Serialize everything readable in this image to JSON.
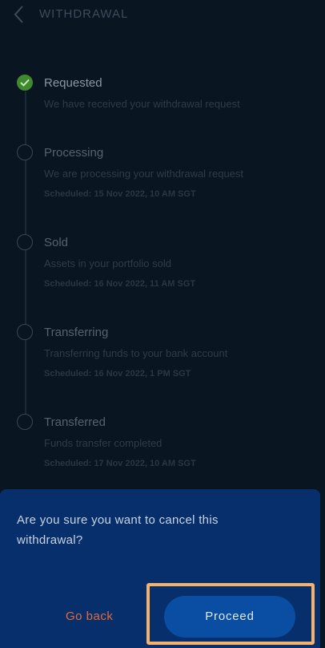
{
  "header": {
    "title": "WITHDRAWAL",
    "back_icon": "chevron-left-icon"
  },
  "steps": [
    {
      "label": "Requested",
      "description": "We have received your withdrawal request",
      "scheduled": "",
      "status": "done"
    },
    {
      "label": "Processing",
      "description": "We are processing your withdrawal request",
      "scheduled": "Scheduled: 15 Nov 2022, 10 AM SGT",
      "status": "pending"
    },
    {
      "label": "Sold",
      "description": "Assets in your portfolio sold",
      "scheduled": "Scheduled: 16 Nov 2022, 11 AM SGT",
      "status": "pending"
    },
    {
      "label": "Transferring",
      "description": "Transferring funds to your bank account",
      "scheduled": "Scheduled: 16 Nov 2022, 1 PM SGT",
      "status": "pending"
    },
    {
      "label": "Transferred",
      "description": "Funds transfer completed",
      "scheduled": "Scheduled: 17 Nov 2022, 10 AM SGT",
      "status": "pending"
    }
  ],
  "dialog": {
    "message": "Are you sure you want to cancel this withdrawal?",
    "cancel_label": "Go back",
    "confirm_label": "Proceed"
  },
  "colors": {
    "sheet": "#062f6b",
    "proceed_button": "#0a4ea3",
    "go_back": "#e36a3a",
    "highlight": "#f6b26b",
    "done_step": "#3f8a2e"
  }
}
